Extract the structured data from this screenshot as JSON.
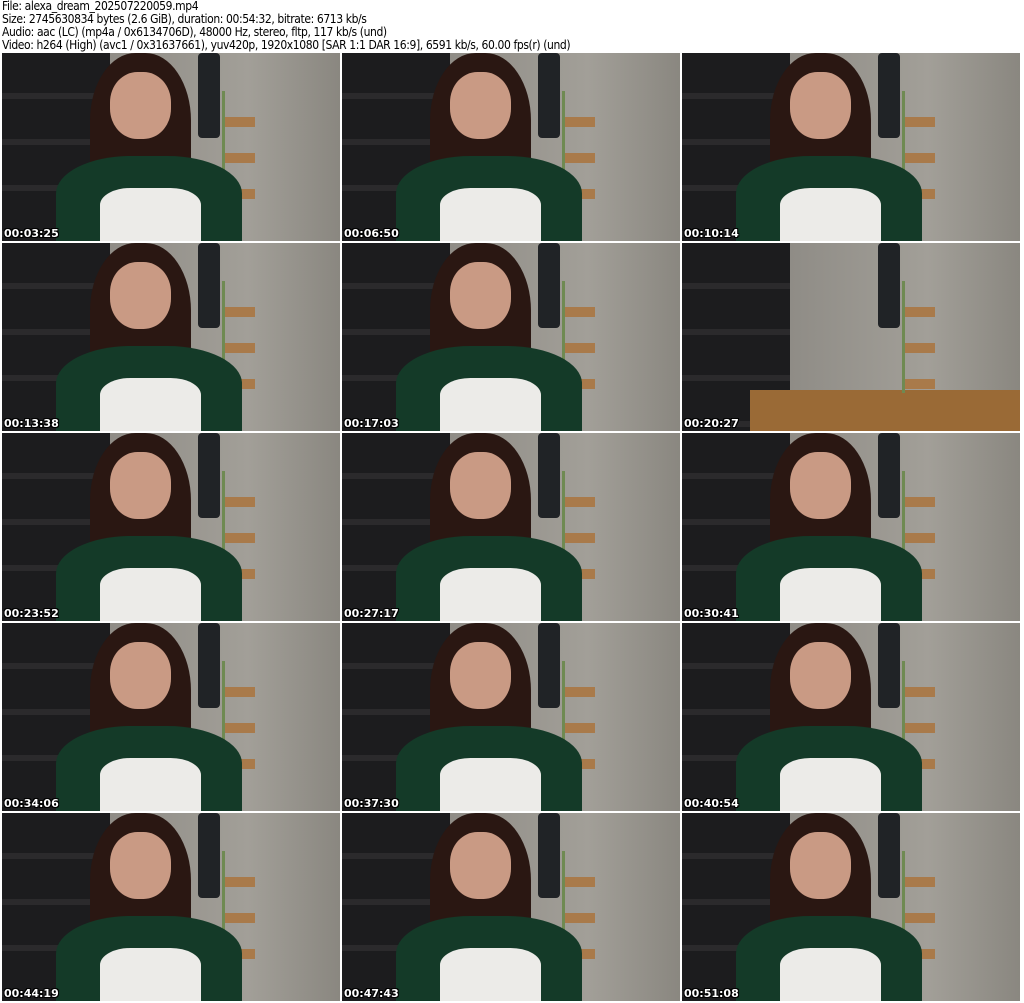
{
  "header": {
    "file": "File: alexa_dream_202507220059.mp4",
    "size": "Size: 2745630834 bytes (2.6 GiB), duration: 00:54:32, bitrate: 6713 kb/s",
    "audio": "Audio: aac (LC) (mp4a / 0x6134706D), 48000 Hz, stereo, fltp, 117 kb/s (und)",
    "video": "Video: h264 (High) (avc1 / 0x31637661), yuv420p, 1920x1080 [SAR 1:1 DAR 16:9], 6591 kb/s, 60.00 fps(r) (und)"
  },
  "thumbnails": [
    {
      "timestamp": "00:03:25"
    },
    {
      "timestamp": "00:06:50"
    },
    {
      "timestamp": "00:10:14"
    },
    {
      "timestamp": "00:13:38"
    },
    {
      "timestamp": "00:17:03"
    },
    {
      "timestamp": "00:20:27"
    },
    {
      "timestamp": "00:23:52"
    },
    {
      "timestamp": "00:27:17"
    },
    {
      "timestamp": "00:30:41"
    },
    {
      "timestamp": "00:34:06"
    },
    {
      "timestamp": "00:37:30"
    },
    {
      "timestamp": "00:40:54"
    },
    {
      "timestamp": "00:44:19"
    },
    {
      "timestamp": "00:47:43"
    },
    {
      "timestamp": "00:51:08"
    }
  ]
}
